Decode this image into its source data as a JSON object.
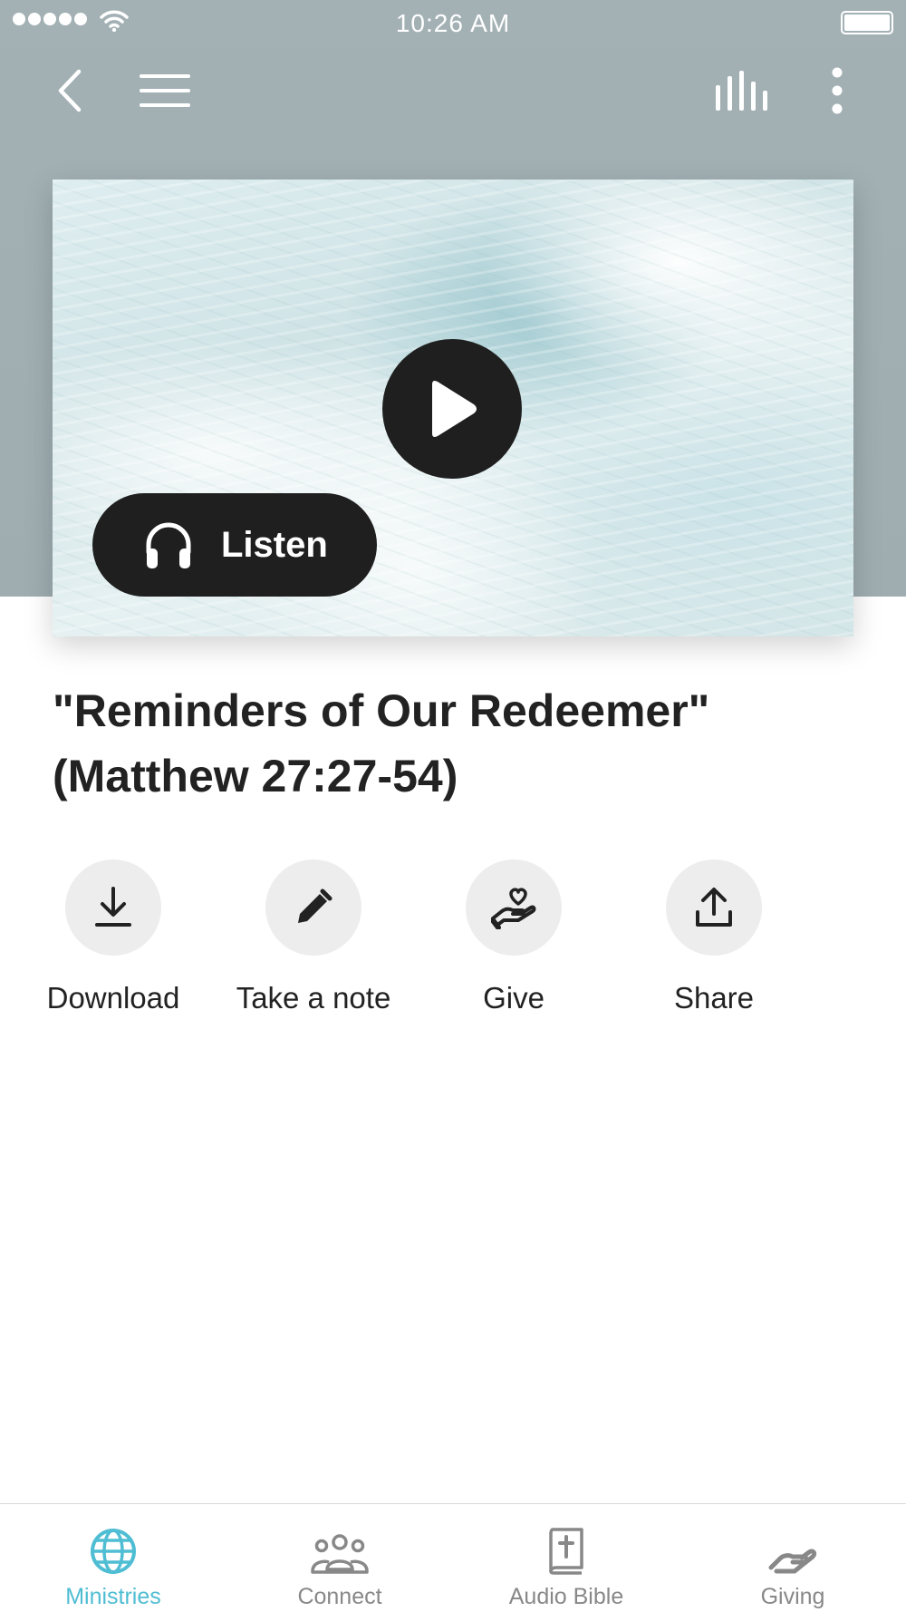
{
  "status_bar": {
    "time": "10:26 AM"
  },
  "nav": {
    "back_icon": "chevron-left-icon",
    "menu_icon": "hamburger-menu-icon",
    "bars_icon": "audio-bars-icon",
    "more_icon": "vertical-ellipsis-icon"
  },
  "hero": {
    "play_icon": "play-icon",
    "listen_label": "Listen",
    "listen_icon": "headphones-icon"
  },
  "sermon": {
    "title": "\"Reminders of Our Redeemer\" (Matthew 27:27-54)"
  },
  "actions": {
    "download": {
      "label": "Download",
      "icon": "download-icon"
    },
    "note": {
      "label": "Take a note",
      "icon": "pencil-icon"
    },
    "give": {
      "label": "Give",
      "icon": "heart-hand-icon"
    },
    "share": {
      "label": "Share",
      "icon": "share-upload-icon"
    }
  },
  "tabs": [
    {
      "label": "Ministries",
      "icon": "globe-icon",
      "active": true
    },
    {
      "label": "Connect",
      "icon": "people-group-icon",
      "active": false
    },
    {
      "label": "Audio Bible",
      "icon": "bible-icon",
      "active": false
    },
    {
      "label": "Giving",
      "icon": "giving-hand-icon",
      "active": false
    }
  ],
  "colors": {
    "header_bg": "#a3b1b5",
    "accent": "#4fbdd3",
    "dark_button": "#1f1f1f",
    "action_circle": "#ededee",
    "inactive_tab": "#888888"
  }
}
